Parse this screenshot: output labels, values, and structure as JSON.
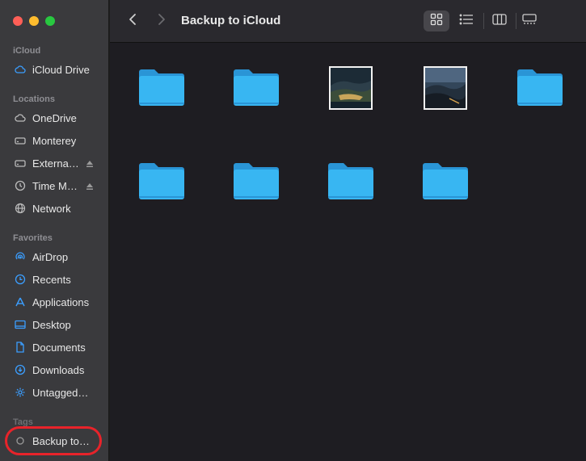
{
  "window": {
    "title": "Backup to iCloud"
  },
  "sidebar": {
    "sections": [
      {
        "title": "iCloud",
        "items": [
          {
            "label": "iCloud Drive",
            "icon": "cloud-icon"
          }
        ]
      },
      {
        "title": "Locations",
        "items": [
          {
            "label": "OneDrive",
            "icon": "cloud-icon"
          },
          {
            "label": "Monterey",
            "icon": "drive-icon"
          },
          {
            "label": "Externa…",
            "icon": "drive-icon"
          },
          {
            "label": "Time M…",
            "icon": "time-machine-icon"
          },
          {
            "label": "Network",
            "icon": "globe-icon"
          }
        ]
      },
      {
        "title": "Favorites",
        "items": [
          {
            "label": "AirDrop",
            "icon": "airdrop-icon"
          },
          {
            "label": "Recents",
            "icon": "clock-icon"
          },
          {
            "label": "Applications",
            "icon": "applications-icon"
          },
          {
            "label": "Desktop",
            "icon": "desktop-icon"
          },
          {
            "label": "Documents",
            "icon": "document-icon"
          },
          {
            "label": "Downloads",
            "icon": "download-icon"
          },
          {
            "label": "Untagged…",
            "icon": "gear-icon"
          }
        ]
      },
      {
        "title": "Tags",
        "items": [
          {
            "label": "Backup to…",
            "icon": "tag-circle-icon"
          }
        ]
      }
    ]
  },
  "content": {
    "items": [
      {
        "type": "folder"
      },
      {
        "type": "folder"
      },
      {
        "type": "image"
      },
      {
        "type": "image"
      },
      {
        "type": "folder"
      },
      {
        "type": "folder"
      },
      {
        "type": "folder"
      },
      {
        "type": "folder"
      },
      {
        "type": "folder"
      }
    ]
  },
  "colors": {
    "accent": "#3b9eff",
    "highlight": "#e8232a",
    "folder": "#38b6f2"
  }
}
